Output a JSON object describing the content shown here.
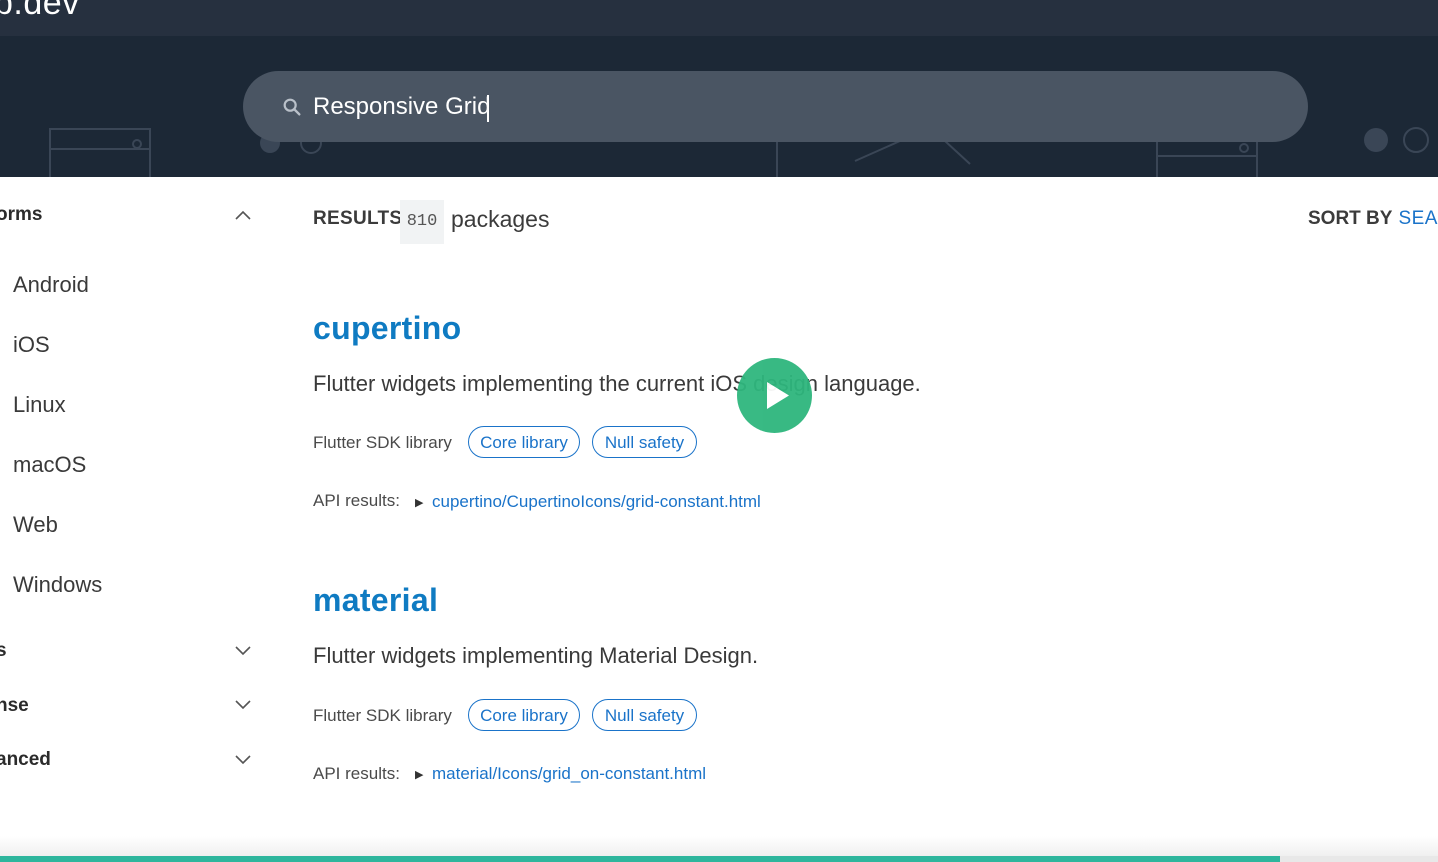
{
  "site": {
    "logo_text": "b.dev"
  },
  "search": {
    "query": "Responsive Grid"
  },
  "sidebar": {
    "platforms_heading": "orms",
    "platforms": [
      "Android",
      "iOS",
      "Linux",
      "macOS",
      "Web",
      "Windows"
    ],
    "collapsed_sections": [
      "s",
      "nse",
      "anced"
    ]
  },
  "results": {
    "label": "RESULTS",
    "count": "810",
    "unit": "packages",
    "sort_label": "SORT BY",
    "sort_value": "SEA"
  },
  "packages": [
    {
      "name": "cupertino",
      "description": "Flutter widgets implementing the current iOS design language.",
      "library": "Flutter SDK library",
      "tags": [
        "Core library",
        "Null safety"
      ],
      "api_label": "API results:",
      "api_link": "cupertino/CupertinoIcons/grid-constant.html"
    },
    {
      "name": "material",
      "description": "Flutter widgets implementing Material Design.",
      "library": "Flutter SDK library",
      "tags": [
        "Core library",
        "Null safety"
      ],
      "api_label": "API results:",
      "api_link": "material/Icons/grid_on-constant.html"
    }
  ],
  "video": {
    "progress_fraction": 0.89
  },
  "colors": {
    "header_bg": "#26303f",
    "banner_bg": "#1c2836",
    "link": "#1a73c9",
    "title": "#0f7bc2",
    "play_button": "#2eb67d",
    "progress": "#2eb69d"
  },
  "icons": {
    "search": "search-icon",
    "expand": "chevron-down-icon",
    "collapse": "chevron-up-icon",
    "play": "play-icon",
    "disclosure": "triangle-right-icon"
  }
}
